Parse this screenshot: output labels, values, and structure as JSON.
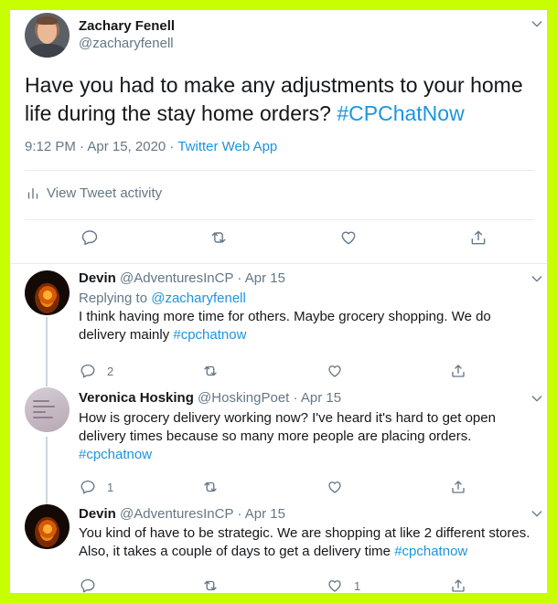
{
  "main_tweet": {
    "name": "Zachary Fenell",
    "handle": "@zacharyfenell",
    "text": "Have you had to make any adjustments to your home life during the stay home orders?",
    "hashtag": "#CPChatNow",
    "time": "9:12 PM · Apr 15, 2020 · ",
    "app": "Twitter Web App",
    "activity_label": "View Tweet activity",
    "icons": [
      "reply-icon",
      "retweet-icon",
      "like-icon",
      "share-icon"
    ]
  },
  "replies": [
    {
      "name": "Devin",
      "handle": "@AdventuresInCP",
      "time": "Apr 15",
      "replying_prefix": "Replying to ",
      "replying_to": "@zacharyfenell",
      "text": "I think having more time for others. Maybe grocery shopping. We do delivery mainly ",
      "hashtag": "#cpchatnow",
      "reply_count": "2",
      "like_count": ""
    },
    {
      "name": "Veronica Hosking",
      "handle": "@HoskingPoet",
      "time": "Apr 15",
      "text": "How is grocery delivery working now? I've heard it's hard to get open delivery times because so many more people are placing orders. ",
      "hashtag": "#cpchatnow",
      "reply_count": "1",
      "like_count": ""
    },
    {
      "name": "Devin",
      "handle": "@AdventuresInCP",
      "time": "Apr 15",
      "text": "You kind of have to be strategic. We are shopping at like 2 different stores. Also, it takes a couple of days to get a delivery time ",
      "hashtag": "#cpchatnow",
      "reply_count": "",
      "like_count": "1"
    }
  ],
  "separator": " · ",
  "colors": {
    "frame": "#c8ff00",
    "link": "#1b95e0",
    "muted": "#657786",
    "text": "#14171a",
    "border": "#e6ecf0"
  }
}
